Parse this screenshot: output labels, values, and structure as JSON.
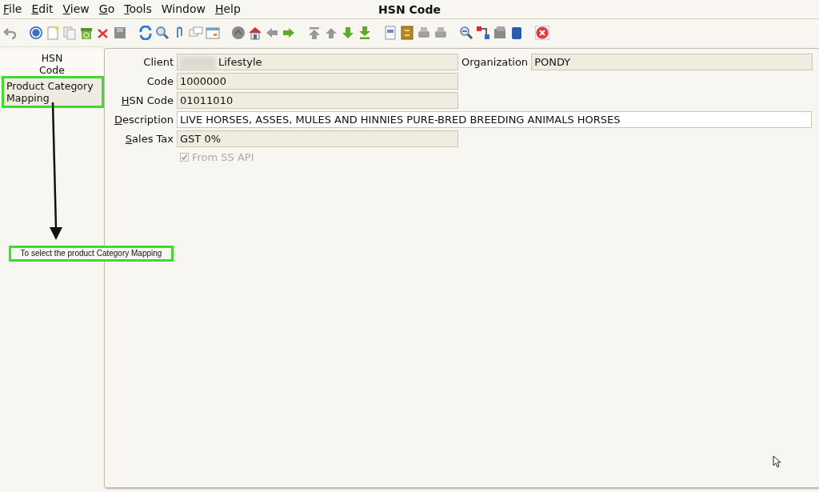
{
  "window": {
    "title": "HSN Code"
  },
  "menu": [
    {
      "mnemonic": "F",
      "rest": "ile"
    },
    {
      "mnemonic": "E",
      "rest": "dit"
    },
    {
      "mnemonic": "V",
      "rest": "iew"
    },
    {
      "mnemonic": "G",
      "rest": "o"
    },
    {
      "mnemonic": "T",
      "rest": "ools"
    },
    {
      "rest": "Window"
    },
    {
      "mnemonic": "H",
      "rest": "elp"
    }
  ],
  "tabs": [
    {
      "label": "HSN Code",
      "selected": true,
      "highlighted": false
    },
    {
      "label": "Product Category Mapping",
      "selected": false,
      "highlighted": true
    }
  ],
  "rows": [
    [
      {
        "label": {
          "rest": "Client"
        },
        "value": "Lifestyle",
        "editable": false,
        "redacted": true
      },
      {
        "label": {
          "rest": "Organization"
        },
        "value": "PONDY",
        "editable": false
      }
    ],
    [
      {
        "label": {
          "rest": "Code"
        },
        "value": "1000000",
        "editable": false
      }
    ],
    [
      {
        "label": {
          "mnemonic": "H",
          "rest": "SN Code"
        },
        "value": "01011010",
        "editable": false
      }
    ],
    [
      {
        "label": {
          "mnemonic": "D",
          "rest": "escription"
        },
        "value": "LIVE HORSES, ASSES, MULES AND HINNIES PURE-BRED BREEDING ANIMALS HORSES",
        "editable": true,
        "wide": true
      }
    ],
    [
      {
        "label": {
          "mnemonic": "S",
          "rest": "ales Tax"
        },
        "value": "GST 0%",
        "editable": false
      }
    ]
  ],
  "checkbox": {
    "label": "From SS API",
    "checked": true,
    "disabled": true
  },
  "annotation": {
    "callout": "To select the product Category Mapping"
  }
}
